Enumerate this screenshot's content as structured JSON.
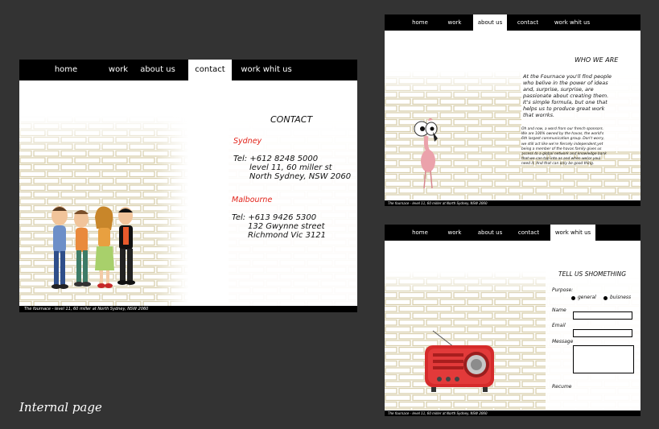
{
  "caption": "Internal page",
  "nav": [
    "home",
    "work",
    "about us",
    "contact",
    "work whit us"
  ],
  "footer": "The fournace - level 11, 60 miller at North Sydney, NSW 2060",
  "contact_page": {
    "heading": "CONTACT",
    "sydney": {
      "city": "Sydney",
      "tel": "Tel: +612 8248 5000",
      "line1": "level 11, 60 miller st",
      "line2": "North Sydney, NSW 2060"
    },
    "melbourne": {
      "city": "Malbourne",
      "tel": "Tel: +613 9426 5300",
      "line1": "132 Gwynne street",
      "line2": "Richmond Vic 3121"
    }
  },
  "about_page": {
    "heading": "WHO WE ARE",
    "para1": [
      "At the Fournace you'll find people",
      "who belive in the power of ideas",
      "and, surprise, surprise, are",
      "passionate about creating them.",
      "It's simple formula, but one that",
      "helps us to produce great work",
      "that worrks."
    ],
    "para2": [
      "Oh and now, a word from our french sponsors.",
      "We are 100% owned by the havas, the world's",
      "6th largest communication group. Don't worry,",
      "we still act like we're fiercely independent,yet",
      "being a member of the havas family gives us",
      "access to a global network and knowledge bank",
      "that we can tap into as and when we(or you)",
      "need it. And that can only be good thing."
    ]
  },
  "work_page": {
    "heading": "TELL US SHOMETHING",
    "purpose_label": "Purpose:",
    "purpose_options": [
      "general",
      "buisness"
    ],
    "name_label": "Name",
    "email_label": "Email",
    "message_label": "Message",
    "resume_label": "Recume"
  },
  "colors": {
    "background": "#333333",
    "accent": "#e2231a",
    "nav": "#000000"
  }
}
